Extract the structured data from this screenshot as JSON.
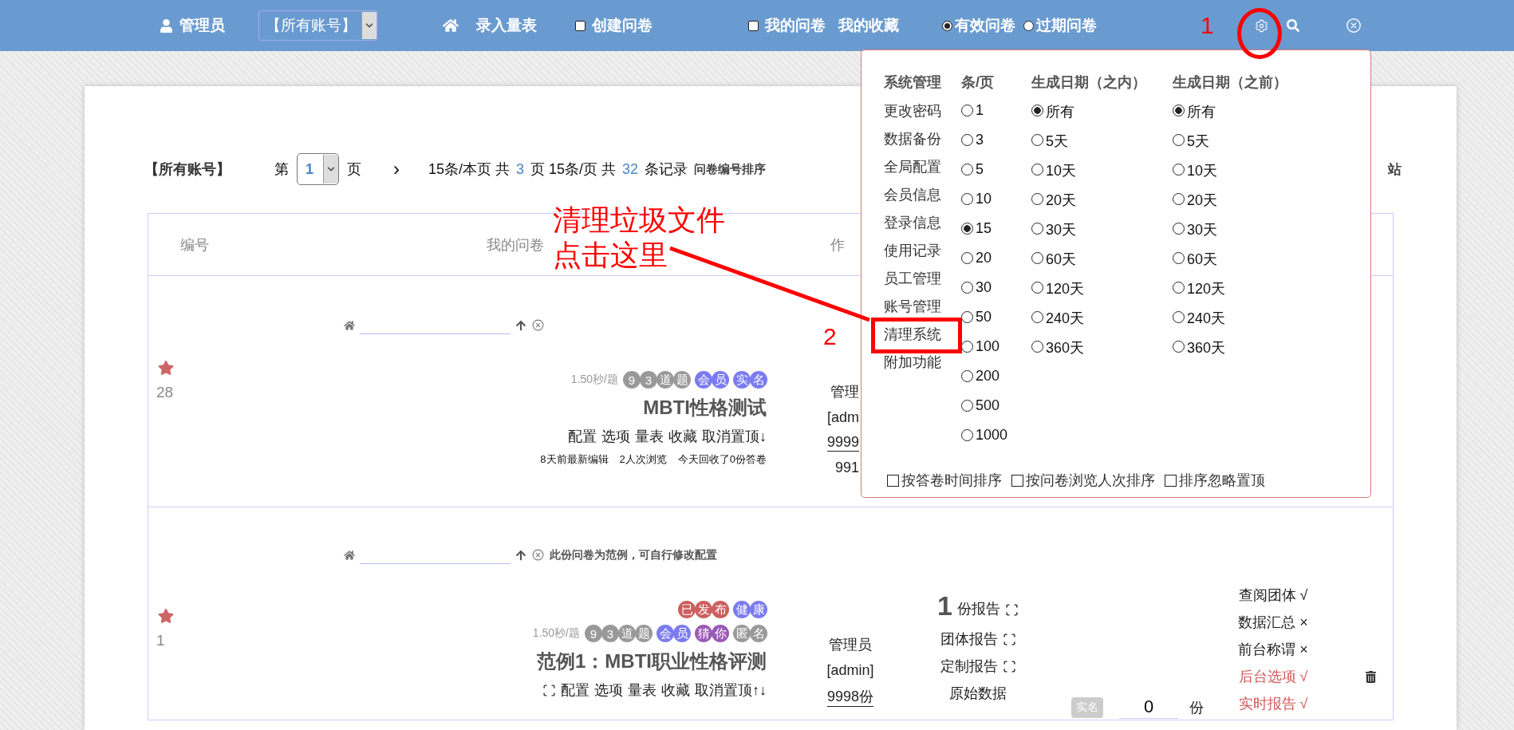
{
  "top_bar": {
    "user": "管理员",
    "account_select": "【所有账号】",
    "enter_scale": "录入量表",
    "create": {
      "label": "创建问卷",
      "checked": false
    },
    "mine": {
      "label": "我的问卷",
      "checked": false
    },
    "favorites": "我的收藏",
    "status_filter": [
      {
        "label": "有效问卷",
        "selected": true
      },
      {
        "label": "过期问卷",
        "selected": false
      }
    ]
  },
  "pagination": {
    "account": "【所有账号】",
    "prefix": "第",
    "page": "1",
    "suffix": "页",
    "next": "›",
    "summary": [
      {
        "text": "15条/本页  共",
        "highlight": false
      },
      {
        "text": "3",
        "highlight": true
      },
      {
        "text": "页  15条/页  共",
        "highlight": false
      },
      {
        "text": "32",
        "highlight": true
      },
      {
        "text": "条记录",
        "highlight": false
      }
    ],
    "sort": "问卷编号排序",
    "site_link": "站"
  },
  "table": {
    "columns": [
      "编号",
      "我的问卷",
      "作"
    ],
    "rows": [
      {
        "starred": true,
        "number": "28",
        "stats": "1.50秒/题",
        "tags": [
          {
            "chars": [
              "9",
              "3",
              "道",
              "题"
            ],
            "color": "#999999"
          },
          {
            "chars": [
              "会",
              "员"
            ],
            "color": "#7b7bf0"
          },
          {
            "chars": [
              "实",
              "名"
            ],
            "color": "#7b7bf0"
          }
        ],
        "title": "MBTI性格测试",
        "scan_icon": false,
        "actions": [
          "配置",
          "选项",
          "量表",
          "收藏",
          "取消置顶↓"
        ],
        "info": [
          "8天前最新编辑",
          "2人次浏览",
          "今天回收了0份答卷"
        ],
        "author": {
          "name": "管理",
          "account": "[adm",
          "count": "9999",
          "extra": "991"
        }
      },
      {
        "starred": true,
        "number": "1",
        "note": "此份问卷为范例，可自行修改配置",
        "status_tags": [
          {
            "chars": [
              "已",
              "发",
              "布"
            ],
            "color": "#cc5f5f"
          },
          {
            "chars": [
              "健",
              "康"
            ],
            "color": "#7b7bf0"
          }
        ],
        "stats": "1.50秒/题",
        "tags": [
          {
            "chars": [
              "9",
              "3",
              "道",
              "题"
            ],
            "color": "#999999"
          },
          {
            "chars": [
              "会",
              "员"
            ],
            "color": "#7b7bf0"
          },
          {
            "chars": [
              "猜",
              "你"
            ],
            "color": "#9b59b6"
          },
          {
            "chars": [
              "匿",
              "名"
            ],
            "color": "#999999"
          }
        ],
        "title": "范例1：MBTI职业性格评测",
        "scan_icon": true,
        "actions": [
          "配置",
          "选项",
          "量表",
          "收藏",
          "取消置顶↑↓"
        ],
        "author": {
          "name": "管理员",
          "account": "[admin]",
          "count": "9998份"
        },
        "reports": {
          "count": "1",
          "count_label": "份报告",
          "items": [
            "团体报告",
            "定制报告"
          ],
          "raw": "原始数据"
        },
        "realname": {
          "badge": "实名",
          "value": "0",
          "unit": "份"
        },
        "flags": [
          {
            "label": "查阅团体 √",
            "highlighted": false
          },
          {
            "label": "数据汇总 ×",
            "highlighted": false
          },
          {
            "label": "前台称谓 ×",
            "highlighted": false
          },
          {
            "label": "后台选项 √",
            "highlighted": true
          },
          {
            "label": "实时报告 √",
            "highlighted": true
          }
        ]
      }
    ]
  },
  "settings_popup": {
    "headers": [
      "系统管理",
      "条/页",
      "生成日期（之内）",
      "生成日期（之前）"
    ],
    "menu": [
      "更改密码",
      "数据备份",
      "全局配置",
      "会员信息",
      "登录信息",
      "使用记录",
      "员工管理",
      "账号管理",
      "清理系统",
      "附加功能"
    ],
    "per_page": [
      {
        "label": "1",
        "selected": false
      },
      {
        "label": "3",
        "selected": false
      },
      {
        "label": "5",
        "selected": false
      },
      {
        "label": "10",
        "selected": false
      },
      {
        "label": "15",
        "selected": true
      },
      {
        "label": "20",
        "selected": false
      },
      {
        "label": "30",
        "selected": false
      },
      {
        "label": "50",
        "selected": false
      },
      {
        "label": "100",
        "selected": false
      },
      {
        "label": "200",
        "selected": false
      },
      {
        "label": "500",
        "selected": false
      },
      {
        "label": "1000",
        "selected": false
      }
    ],
    "within": [
      {
        "label": "所有",
        "selected": true
      },
      {
        "label": "5天",
        "selected": false
      },
      {
        "label": "10天",
        "selected": false
      },
      {
        "label": "20天",
        "selected": false
      },
      {
        "label": "30天",
        "selected": false
      },
      {
        "label": "60天",
        "selected": false
      },
      {
        "label": "120天",
        "selected": false
      },
      {
        "label": "240天",
        "selected": false
      },
      {
        "label": "360天",
        "selected": false
      }
    ],
    "before": [
      {
        "label": "所有",
        "selected": true
      },
      {
        "label": "5天",
        "selected": false
      },
      {
        "label": "10天",
        "selected": false
      },
      {
        "label": "20天",
        "selected": false
      },
      {
        "label": "30天",
        "selected": false
      },
      {
        "label": "60天",
        "selected": false
      },
      {
        "label": "120天",
        "selected": false
      },
      {
        "label": "240天",
        "selected": false
      },
      {
        "label": "360天",
        "selected": false
      }
    ],
    "sort_options": [
      {
        "label": "按答卷时间排序",
        "checked": false
      },
      {
        "label": "按问卷浏览人次排序",
        "checked": false
      },
      {
        "label": "排序忽略置顶",
        "checked": false
      }
    ]
  },
  "annotations": {
    "step_1": "1",
    "step_2": "2",
    "callout": [
      "清理垃圾文件",
      "点击这里"
    ]
  }
}
